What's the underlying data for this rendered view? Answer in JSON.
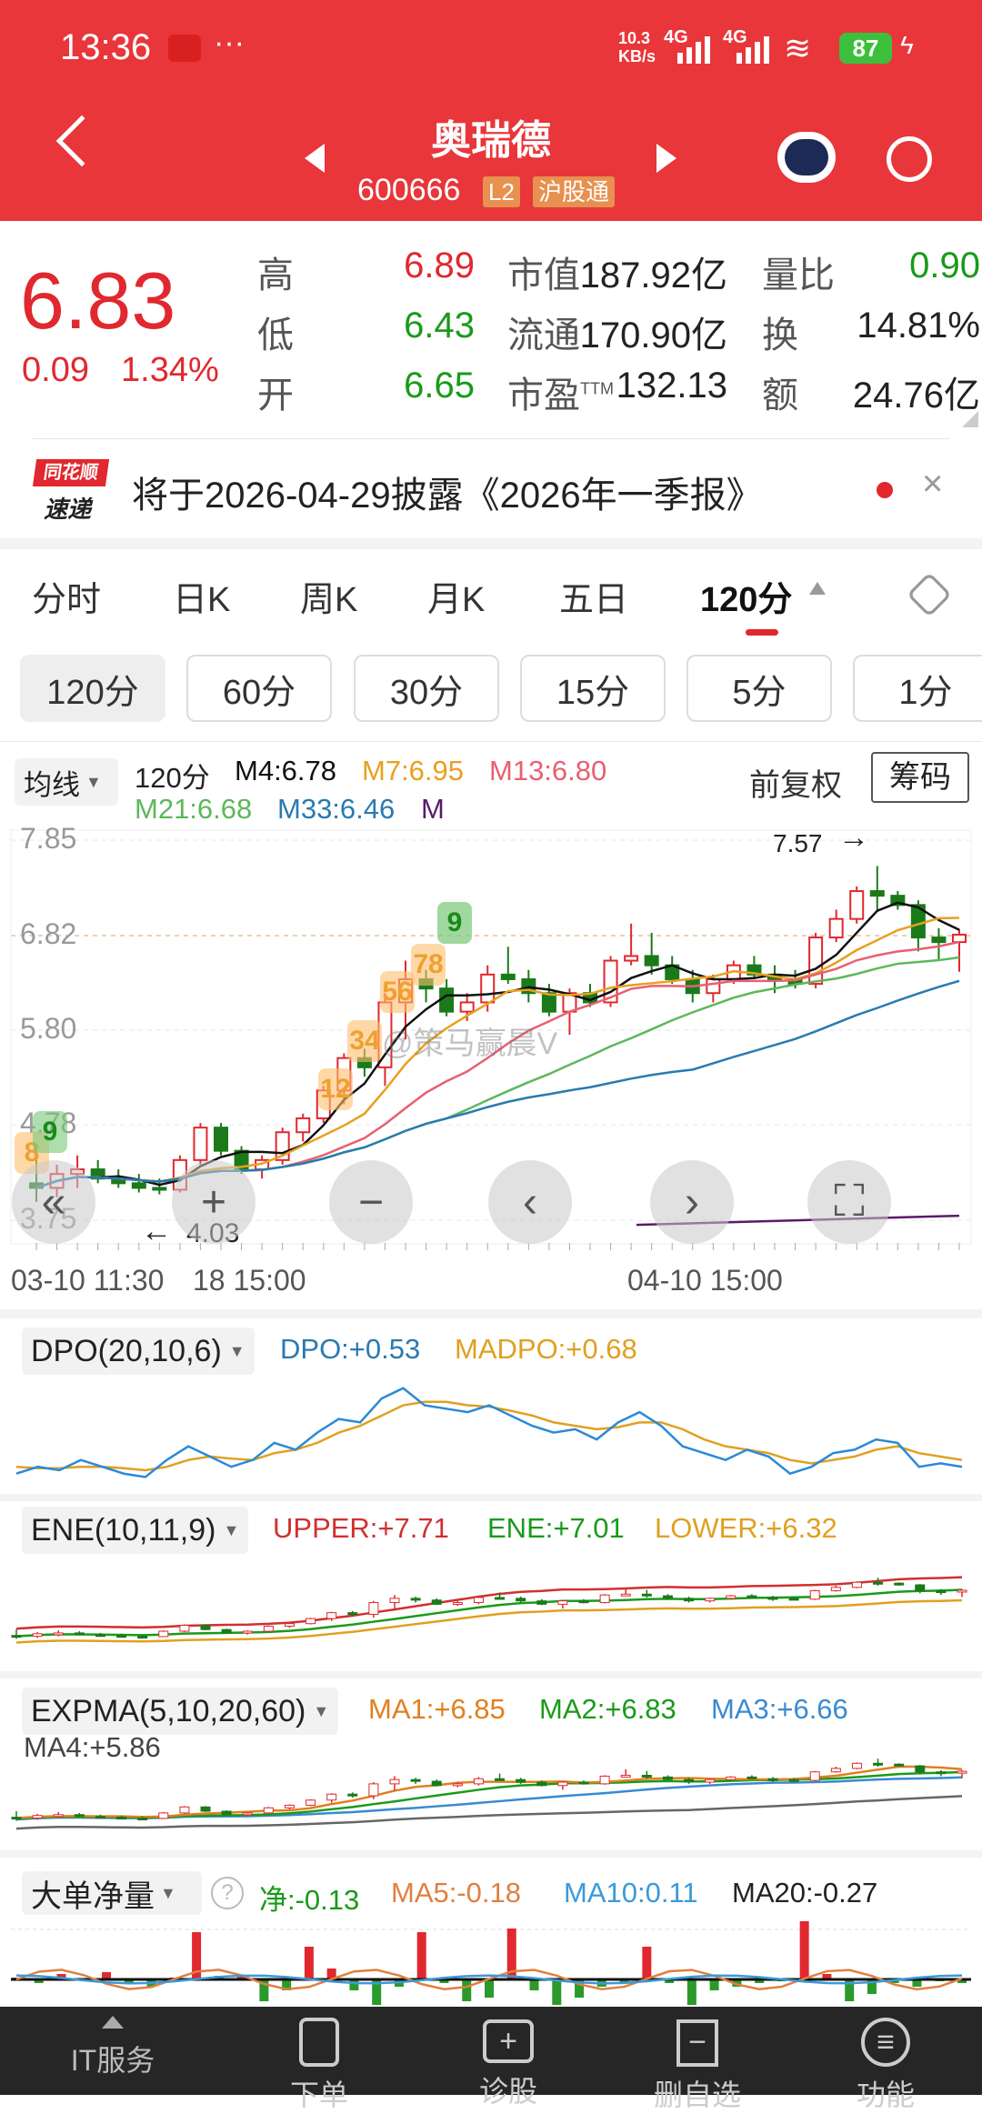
{
  "status_bar": {
    "time": "13:36",
    "dots": "···",
    "net_speed": "10.3 KB/s",
    "signal1": "4G",
    "signal2": "4G",
    "battery": "87"
  },
  "header": {
    "stock_name": "奥瑞德",
    "code": "600666",
    "badge_l2": "L2",
    "badge_connect": "沪股通"
  },
  "quote": {
    "price": "6.83",
    "change": "0.09",
    "change_pct": "1.34%",
    "rows": [
      {
        "l1": "高",
        "v1": "6.89",
        "l2": "市值",
        "v2": "187.92亿",
        "l3": "量比",
        "v3": "0.90"
      },
      {
        "l1": "低",
        "v1": "6.43",
        "l2": "流通",
        "v2": "170.90亿",
        "l3": "换",
        "v3": "14.81%"
      },
      {
        "l1": "开",
        "v1": "6.65",
        "l2": "市盈",
        "l2sup": "TTM",
        "v2": "132.13",
        "l3": "额",
        "v3": "24.76亿"
      }
    ]
  },
  "notice": {
    "logo_top": "同花顺",
    "logo_bottom": "速递",
    "text": "将于2026-04-29披露《2026年一季报》",
    "close": "×"
  },
  "tabs": [
    "分时",
    "日K",
    "周K",
    "月K",
    "五日",
    "120分"
  ],
  "active_tab": "120分",
  "sub_tabs": [
    "120分",
    "60分",
    "30分",
    "15分",
    "5分",
    "1分"
  ],
  "ma_legend": {
    "selector": "均线",
    "period": "120分",
    "m4": "M4:6.78",
    "m7": "M7:6.95",
    "m13": "M13:6.80",
    "m21": "M21:6.68",
    "m33": "M33:6.46",
    "m60": "M",
    "adjust": "前复权",
    "chips": "筹码"
  },
  "colors": {
    "up": "#e0282e",
    "down": "#1a7a1a",
    "m4": "#111111",
    "m7": "#e8a020",
    "m13": "#e86070",
    "m21": "#5cb85c",
    "m33": "#2a7ab0",
    "m60": "#5a1a6a"
  },
  "watermark": "@策马赢晨V",
  "annotations": {
    "high": "7.57",
    "low": "4.03",
    "high_arrow": "→",
    "low_arrow": "←"
  },
  "count_badges": [
    "8",
    "9",
    "12",
    "34",
    "56",
    "78",
    "9"
  ],
  "controls": {
    "back_fast": "«",
    "zoom_in": "+",
    "zoom_out": "−",
    "prev": "‹",
    "next": "›",
    "fullscreen": "⛶"
  },
  "chart_data": {
    "type": "candlestick",
    "y_ticks": [
      "7.85",
      "6.82",
      "5.80",
      "4.78",
      "3.75"
    ],
    "ylim": [
      3.75,
      7.85
    ],
    "x_labels": [
      "03-10 11:30",
      "18 15:00",
      "04-10 15:00"
    ],
    "candles": [
      [
        4.15,
        4.5,
        3.95,
        4.1
      ],
      [
        4.1,
        4.35,
        4.0,
        4.25
      ],
      [
        4.25,
        4.45,
        4.1,
        4.3
      ],
      [
        4.3,
        4.4,
        4.15,
        4.2
      ],
      [
        4.2,
        4.3,
        4.1,
        4.15
      ],
      [
        4.15,
        4.25,
        4.05,
        4.1
      ],
      [
        4.1,
        4.2,
        4.03,
        4.08
      ],
      [
        4.08,
        4.45,
        4.05,
        4.4
      ],
      [
        4.4,
        4.8,
        4.35,
        4.75
      ],
      [
        4.75,
        4.8,
        4.45,
        4.5
      ],
      [
        4.5,
        4.55,
        4.25,
        4.3
      ],
      [
        4.3,
        4.45,
        4.2,
        4.4
      ],
      [
        4.4,
        4.75,
        4.35,
        4.7
      ],
      [
        4.7,
        4.9,
        4.6,
        4.85
      ],
      [
        4.85,
        5.2,
        4.8,
        5.15
      ],
      [
        5.15,
        5.55,
        5.0,
        5.5
      ],
      [
        5.5,
        5.6,
        5.3,
        5.4
      ],
      [
        5.4,
        6.2,
        5.2,
        6.1
      ],
      [
        6.1,
        6.55,
        5.7,
        6.35
      ],
      [
        6.35,
        6.45,
        6.1,
        6.25
      ],
      [
        6.25,
        6.35,
        5.95,
        6.0
      ],
      [
        6.0,
        6.2,
        5.9,
        6.1
      ],
      [
        6.1,
        6.5,
        6.0,
        6.4
      ],
      [
        6.4,
        6.7,
        6.3,
        6.35
      ],
      [
        6.35,
        6.45,
        6.1,
        6.2
      ],
      [
        6.2,
        6.3,
        5.95,
        6.0
      ],
      [
        6.0,
        6.25,
        5.75,
        6.2
      ],
      [
        6.2,
        6.3,
        6.05,
        6.1
      ],
      [
        6.1,
        6.6,
        6.05,
        6.55
      ],
      [
        6.55,
        6.95,
        6.5,
        6.6
      ],
      [
        6.6,
        6.85,
        6.4,
        6.5
      ],
      [
        6.5,
        6.6,
        6.3,
        6.35
      ],
      [
        6.35,
        6.45,
        6.1,
        6.2
      ],
      [
        6.2,
        6.4,
        6.1,
        6.35
      ],
      [
        6.35,
        6.55,
        6.3,
        6.5
      ],
      [
        6.5,
        6.6,
        6.35,
        6.4
      ],
      [
        6.4,
        6.5,
        6.2,
        6.35
      ],
      [
        6.35,
        6.45,
        6.25,
        6.3
      ],
      [
        6.3,
        6.85,
        6.25,
        6.8
      ],
      [
        6.8,
        7.1,
        6.75,
        7.0
      ],
      [
        7.0,
        7.35,
        6.95,
        7.3
      ],
      [
        7.3,
        7.57,
        7.1,
        7.25
      ],
      [
        7.25,
        7.3,
        7.1,
        7.15
      ],
      [
        7.15,
        7.2,
        6.65,
        6.8
      ],
      [
        6.8,
        6.9,
        6.55,
        6.75
      ],
      [
        6.75,
        6.89,
        6.43,
        6.83
      ]
    ],
    "ma_periods": [
      4,
      7,
      13,
      21,
      33
    ]
  },
  "dpo": {
    "title": "DPO(20,10,6)",
    "dpo": "DPO:+0.53",
    "madpo": "MADPO:+0.68",
    "dpo_values": [
      -0.3,
      -0.2,
      -0.25,
      -0.1,
      -0.2,
      -0.3,
      -0.35,
      -0.1,
      0.1,
      -0.05,
      -0.2,
      -0.1,
      0.15,
      0.05,
      0.3,
      0.5,
      0.45,
      0.8,
      0.95,
      0.7,
      0.65,
      0.6,
      0.7,
      0.55,
      0.4,
      0.3,
      0.35,
      0.2,
      0.45,
      0.6,
      0.4,
      0.1,
      0.0,
      -0.1,
      0.05,
      -0.05,
      -0.3,
      -0.2,
      0.0,
      0.05,
      0.2,
      0.15,
      -0.2,
      -0.15,
      -0.2
    ],
    "madpo_values": [
      -0.2,
      -0.22,
      -0.22,
      -0.2,
      -0.2,
      -0.22,
      -0.25,
      -0.2,
      -0.1,
      -0.05,
      -0.08,
      -0.1,
      0.0,
      0.05,
      0.15,
      0.3,
      0.4,
      0.55,
      0.7,
      0.75,
      0.75,
      0.7,
      0.68,
      0.62,
      0.55,
      0.45,
      0.4,
      0.35,
      0.38,
      0.45,
      0.45,
      0.35,
      0.2,
      0.1,
      0.05,
      0.0,
      -0.1,
      -0.15,
      -0.1,
      -0.05,
      0.05,
      0.1,
      0.0,
      -0.05,
      -0.1
    ]
  },
  "ene": {
    "title": "ENE(10,11,9)",
    "upper": "UPPER:+7.71",
    "ene": "ENE:+7.01",
    "lower": "LOWER:+6.32"
  },
  "expma": {
    "title": "EXPMA(5,10,20,60)",
    "ma1": "MA1:+6.85",
    "ma2": "MA2:+6.83",
    "ma3": "MA3:+6.66",
    "ma4": "MA4:+5.86"
  },
  "big_order": {
    "title": "大单净量",
    "help": "?",
    "net": "净:-0.13",
    "ma5": "MA5:-0.18",
    "ma10": "MA10:0.11",
    "ma20": "MA20:-0.27",
    "bars": [
      0.05,
      -0.1,
      0.15,
      -0.05,
      0.2,
      -0.1,
      -0.2,
      0.05,
      1.3,
      0.1,
      0.1,
      -0.6,
      -0.3,
      0.9,
      0.3,
      -0.3,
      -0.7,
      -0.2,
      1.3,
      -0.1,
      -0.6,
      -0.5,
      1.4,
      -0.3,
      -0.7,
      -0.5,
      -0.2,
      -0.1,
      0.9,
      -0.1,
      -0.7,
      -0.3,
      -0.2,
      -0.1,
      -0.05,
      1.6,
      0.15,
      -0.6,
      -0.4,
      -0.1,
      -0.2,
      -0.05,
      -0.1
    ]
  },
  "bottom_nav": [
    "IT服务",
    "下单",
    "诊股",
    "删自选",
    "功能"
  ]
}
